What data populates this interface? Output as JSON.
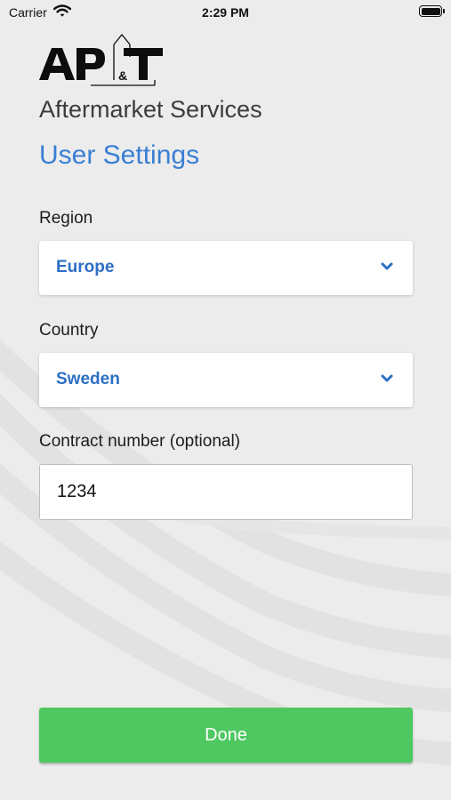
{
  "status_bar": {
    "carrier": "Carrier",
    "time": "2:29 PM",
    "battery_level": 1.0
  },
  "brand": {
    "logo_text": "AP&T",
    "subtitle": "Aftermarket Services"
  },
  "page": {
    "title": "User Settings"
  },
  "form": {
    "region": {
      "label": "Region",
      "value": "Europe"
    },
    "country": {
      "label": "Country",
      "value": "Sweden"
    },
    "contract": {
      "label": "Contract number (optional)",
      "value": "1234"
    }
  },
  "actions": {
    "done_label": "Done"
  },
  "colors": {
    "accent_blue": "#3a7fd4",
    "done_green": "#4fc861",
    "background": "#ececec"
  },
  "icons": [
    "wifi-icon",
    "battery-icon",
    "chevron-down-icon"
  ]
}
